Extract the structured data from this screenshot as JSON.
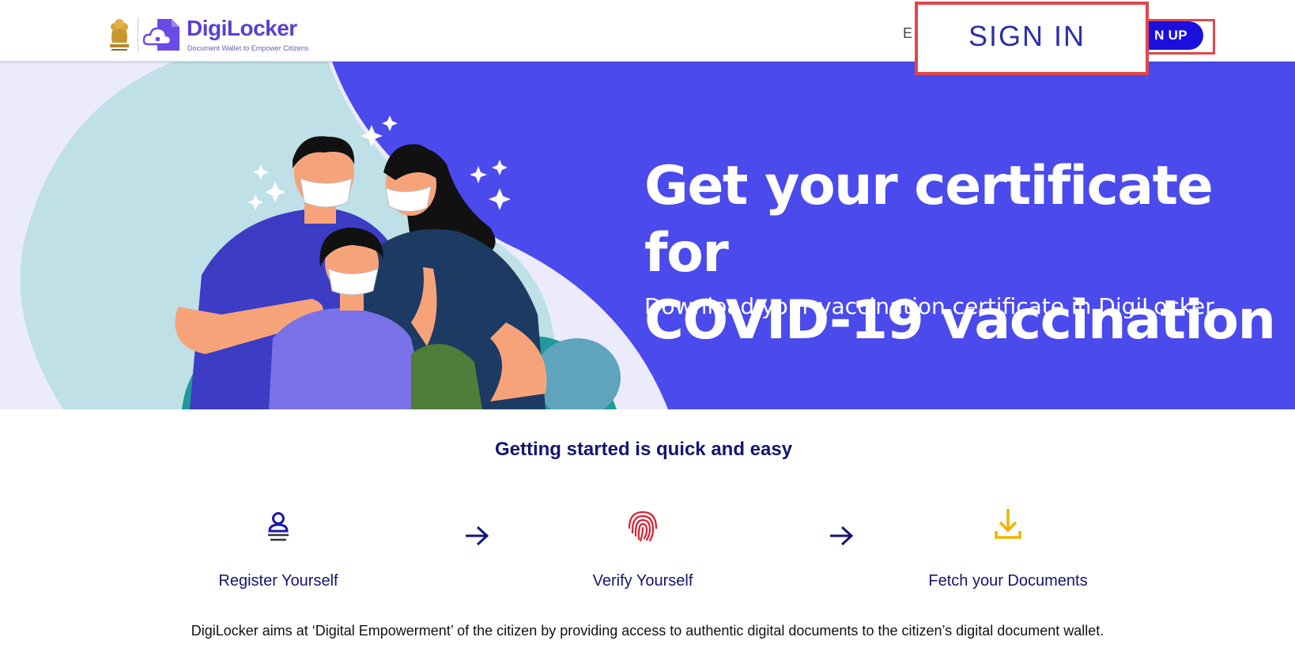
{
  "header": {
    "brand_name": "DigiLocker",
    "brand_tagline": "Document Wallet to Empower Citizens",
    "language_partial": "E",
    "signin_label": "SIGN IN",
    "signup_label": "N UP"
  },
  "banner": {
    "title_line1": "Get your certificate for",
    "title_line2": "COVID-19 vaccination",
    "subtitle": "Download your vaccination certificate in DigiLocker"
  },
  "steps": {
    "title": "Getting started is quick and easy",
    "items": [
      {
        "label": "Register Yourself",
        "icon": "user-register-icon"
      },
      {
        "label": "Verify Yourself",
        "icon": "fingerprint-icon"
      },
      {
        "label": "Fetch your Documents",
        "icon": "download-icon"
      }
    ]
  },
  "footer": {
    "description": "DigiLocker aims at ‘Digital Empowerment’ of the citizen by providing access to authentic digital documents to the citizen’s digital document wallet."
  },
  "colors": {
    "brand": "#5a3fd6",
    "primary": "#1a0fdd",
    "banner_bg": "#4a4aed",
    "highlight": "#e0474c",
    "heading": "#141470"
  }
}
